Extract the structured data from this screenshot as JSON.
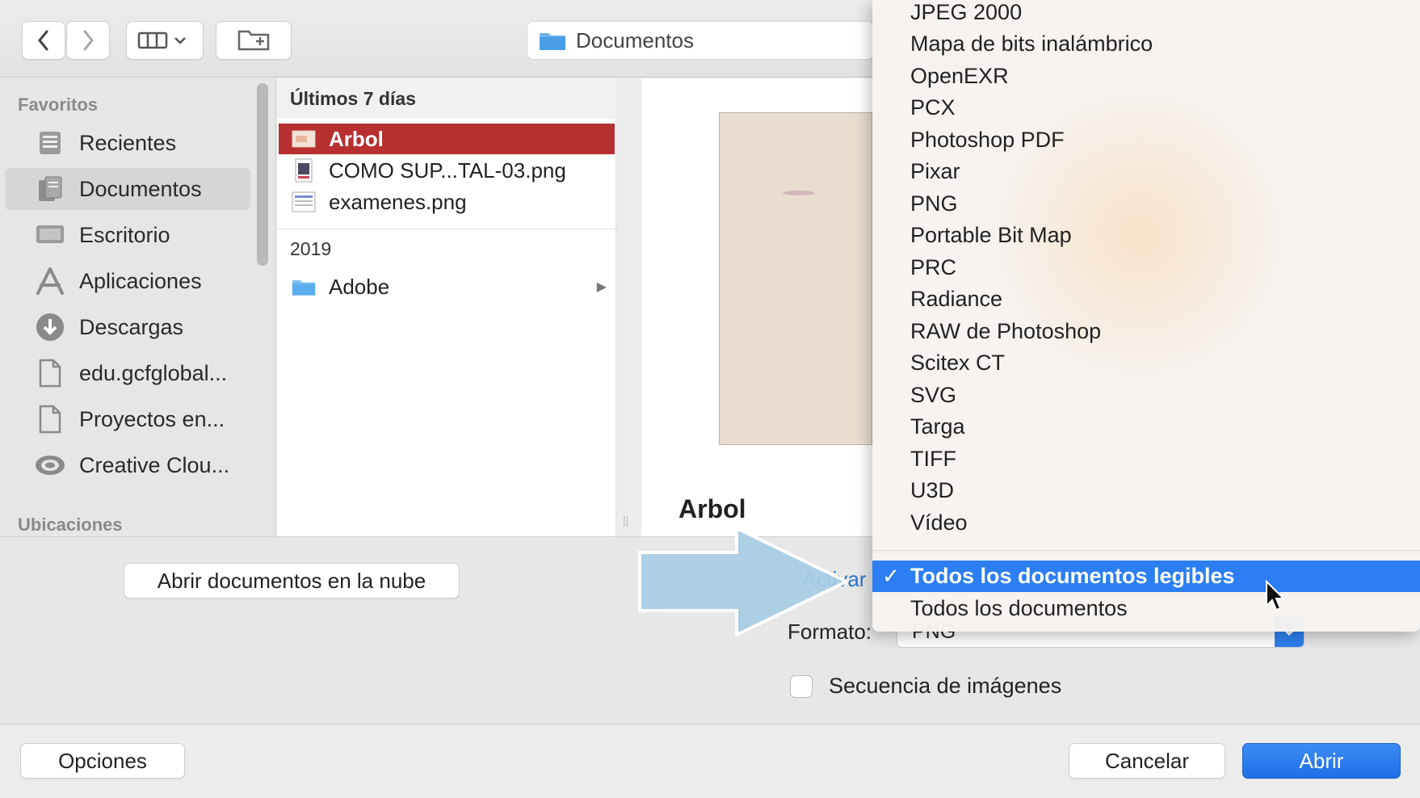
{
  "toolbar": {
    "back_icon": "chevron-left-icon",
    "forward_icon": "chevron-right-icon",
    "view_icon": "column-view-icon",
    "new_folder_icon": "new-folder-icon",
    "location": "Documentos"
  },
  "sidebar": {
    "favorites_heading": "Favoritos",
    "items": [
      {
        "label": "Recientes",
        "icon": "recents-icon"
      },
      {
        "label": "Documentos",
        "icon": "documents-icon",
        "selected": true
      },
      {
        "label": "Escritorio",
        "icon": "desktop-icon"
      },
      {
        "label": "Aplicaciones",
        "icon": "applications-icon"
      },
      {
        "label": "Descargas",
        "icon": "downloads-icon"
      },
      {
        "label": "edu.gcfglobal...",
        "icon": "document-icon"
      },
      {
        "label": "Proyectos en...",
        "icon": "document-icon"
      },
      {
        "label": "Creative Clou...",
        "icon": "creative-cloud-icon"
      }
    ],
    "locations_heading": "Ubicaciones"
  },
  "files": {
    "recent_heading": "Últimos 7 días",
    "recent": [
      {
        "name": "Arbol",
        "selected": true
      },
      {
        "name": "COMO SUP...TAL-03.png"
      },
      {
        "name": "examenes.png"
      }
    ],
    "year_heading": "2019",
    "older": [
      {
        "name": "Adobe",
        "is_folder": true
      }
    ]
  },
  "preview": {
    "name": "Arbol"
  },
  "options": {
    "cloud_button": "Abrir documentos en la nube",
    "activar_label": "Activar",
    "format_label": "Formato:",
    "format_value": "PNG",
    "sequence_label": "Secuencia de imágenes",
    "sequence_checked": false
  },
  "footer": {
    "options_button": "Opciones",
    "cancel_button": "Cancelar",
    "open_button": "Abrir"
  },
  "menu": {
    "items": [
      "JPEG 2000",
      "Mapa de bits inalámbrico",
      "OpenEXR",
      "PCX",
      "Photoshop PDF",
      "Pixar",
      "PNG",
      "Portable Bit Map",
      "PRC",
      "Radiance",
      "RAW de Photoshop",
      "Scitex CT",
      "SVG",
      "Targa",
      "TIFF",
      "U3D",
      "Vídeo"
    ],
    "check_mark": "✓",
    "all_readable": "Todos los documentos legibles",
    "all_documents": "Todos los documentos"
  },
  "colors": {
    "selection_red": "#b72f2f",
    "accent_blue": "#2b7ff2",
    "arrow_overlay": "#a9cde6"
  }
}
